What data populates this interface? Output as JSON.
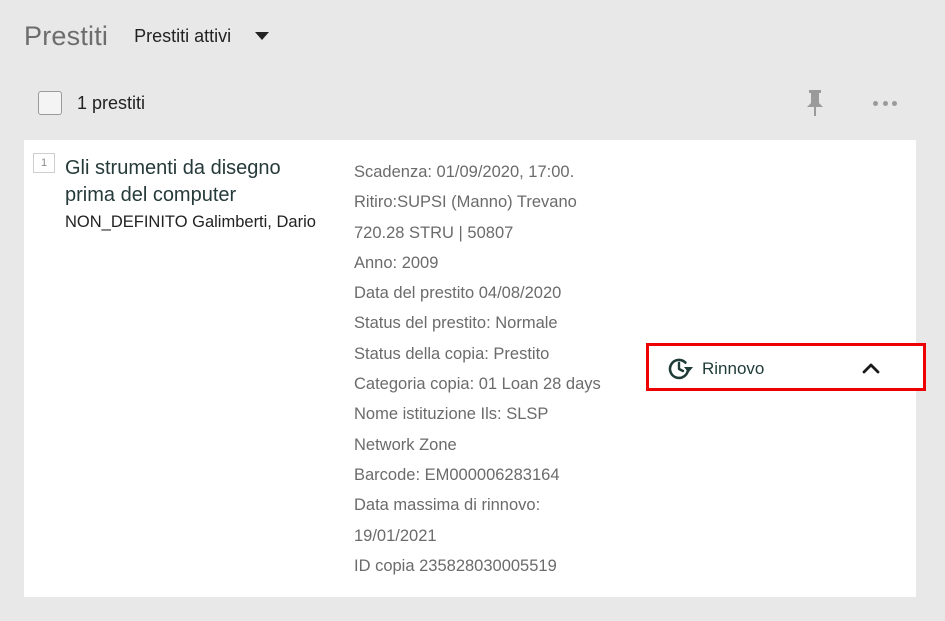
{
  "header": {
    "title": "Prestiti",
    "filter_label": "Prestiti attivi"
  },
  "toolbar": {
    "count_label": "1 prestiti"
  },
  "loan": {
    "index": "1",
    "title_line1": "Gli strumenti da disegno",
    "title_line2": "prima del computer",
    "author": "NON_DEFINITO Galimberti, Dario",
    "details": [
      "Scadenza: 01/09/2020, 17:00.",
      "Ritiro:SUPSI (Manno) Trevano",
      "720.28 STRU | 50807",
      "Anno: 2009",
      "Data del prestito 04/08/2020",
      "Status del prestito: Normale",
      "Status della copia: Prestito",
      "Categoria copia: 01 Loan 28 days",
      "Nome istituzione Ils: SLSP",
      "Network Zone",
      "Barcode: EM000006283164",
      "Data massima di rinnovo:",
      "19/01/2021",
      "ID copia 235828030005519"
    ],
    "renew_label": "Rinnovo"
  },
  "icons": {
    "pin": "pin-icon",
    "more": "more-horizontal-icon",
    "renew": "clock-renew-icon",
    "collapse": "chevron-up-icon",
    "dropdown": "caret-down-icon"
  },
  "colors": {
    "background": "#e8e8e8",
    "card": "#ffffff",
    "accent_dark_green": "#1f3b37",
    "highlight_red": "#ee0000",
    "muted_text": "#6b6b6b"
  }
}
